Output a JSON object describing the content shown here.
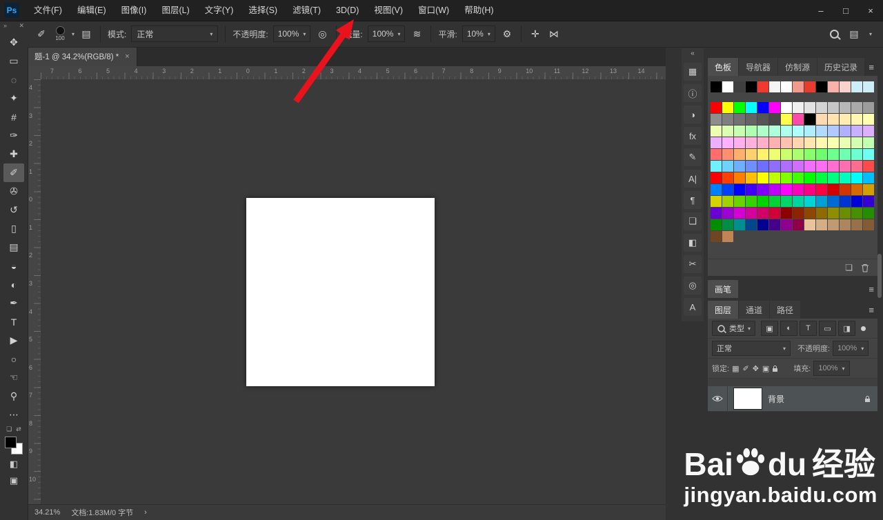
{
  "glyphs": {
    "chevron": "▾",
    "menu": "≡",
    "back": "›"
  },
  "colors": {
    "arrow_red": "#e8131c",
    "canvas_bg": "#3a3a3a",
    "panel_bg": "#434343"
  },
  "menubar": {
    "logo": "Ps",
    "items": [
      "文件(F)",
      "编辑(E)",
      "图像(I)",
      "图层(L)",
      "文字(Y)",
      "选择(S)",
      "滤镜(T)",
      "3D(D)",
      "视图(V)",
      "窗口(W)",
      "帮助(H)"
    ],
    "minimize": "–",
    "maximize": "□",
    "close": "×"
  },
  "left_dock": {
    "collapse": "»",
    "close": "✕",
    "tools": [
      {
        "name": "move-tool",
        "glyph": "✥"
      },
      {
        "name": "marquee-tool",
        "glyph": "▭"
      },
      {
        "name": "lasso-tool",
        "glyph": "◌"
      },
      {
        "name": "quick-selection-tool",
        "glyph": "✦"
      },
      {
        "name": "crop-tool",
        "glyph": "#"
      },
      {
        "name": "eyedropper-tool",
        "glyph": "✑"
      },
      {
        "name": "spot-healing-tool",
        "glyph": "✚"
      },
      {
        "name": "brush-tool",
        "glyph": "✐",
        "selected": true
      },
      {
        "name": "clone-stamp-tool",
        "glyph": "✇"
      },
      {
        "name": "history-brush-tool",
        "glyph": "↺"
      },
      {
        "name": "eraser-tool",
        "glyph": "▯"
      },
      {
        "name": "gradient-tool",
        "glyph": "▤"
      },
      {
        "name": "blur-tool",
        "glyph": "◒"
      },
      {
        "name": "dodge-tool",
        "glyph": "◐"
      },
      {
        "name": "pen-tool",
        "glyph": "✒"
      },
      {
        "name": "type-tool",
        "glyph": "T"
      },
      {
        "name": "path-selection-tool",
        "glyph": "▶"
      },
      {
        "name": "shape-tool",
        "glyph": "○"
      },
      {
        "name": "hand-tool",
        "glyph": "☜"
      },
      {
        "name": "zoom-tool",
        "glyph": "⚲"
      },
      {
        "name": "edit-toolbar-button",
        "glyph": "⋯"
      }
    ],
    "default_colors": "❏",
    "swap_colors": "⇄",
    "quick_mask": "◧",
    "screen_mode": "▣"
  },
  "options_bar": {
    "brush_icon": "✐",
    "brush_size": "100",
    "panel_toggle": "▤",
    "mode_label": "模式:",
    "mode_value": "正常",
    "opacity_label": "不透明度:",
    "opacity_value": "100%",
    "pressure_icon": "◎",
    "flow_label": "流量:",
    "flow_value": "100%",
    "airbrush_icon": "≋",
    "smooth_label": "平滑:",
    "smooth_value": "10%",
    "gear": "⚙",
    "angle_icon": "✛",
    "symmetry_icon": "⋈",
    "workspace_icon": "▤"
  },
  "document_tab": {
    "title": "题-1 @ 34.2%(RGB/8) *",
    "close": "×"
  },
  "rulers": {
    "top": [
      "7",
      "6",
      "5",
      "4",
      "3",
      "2",
      "1",
      "0",
      "1",
      "2",
      "3",
      "4",
      "5",
      "6",
      "7",
      "8",
      "9",
      "10",
      "11",
      "12",
      "13",
      "14"
    ],
    "left": [
      "4",
      "3",
      "2",
      "1",
      "0",
      "1",
      "2",
      "3",
      "4",
      "5",
      "6",
      "7",
      "8",
      "9",
      "10"
    ]
  },
  "status_bar": {
    "zoom": "34.21%",
    "doc_info": "文档:1.83M/0 字节",
    "chevron": "›"
  },
  "right_dock": {
    "collapse": "«",
    "panel_menu": "≡",
    "panel_icons": [
      {
        "name": "swatches-panel-icon",
        "glyph": "▦"
      },
      {
        "name": "info-panel-icon",
        "glyph": "ⓘ"
      },
      {
        "name": "gradient-panel-icon",
        "glyph": "◑"
      },
      {
        "name": "effects-panel-icon",
        "glyph": "fx"
      },
      {
        "name": "brush-settings-panel-icon",
        "glyph": "✎"
      },
      {
        "name": "character-panel-icon",
        "glyph": "A|"
      },
      {
        "name": "paragraph-panel-icon",
        "glyph": "¶"
      },
      {
        "name": "libraries-panel-icon",
        "glyph": "❏"
      },
      {
        "name": "adjustments-panel-icon",
        "glyph": "◧"
      },
      {
        "name": "tool-presets-panel-icon",
        "glyph": "✂"
      },
      {
        "name": "clone-source-panel-icon",
        "glyph": "◎"
      },
      {
        "name": "glyphs-panel-icon",
        "glyph": "A"
      }
    ],
    "panel_tabs": [
      {
        "label": "色板",
        "active": true
      },
      {
        "label": "导航器"
      },
      {
        "label": "仿制源"
      },
      {
        "label": "历史记录"
      }
    ],
    "swatches": {
      "recent": [
        "#000000",
        "#ffffff",
        "#3f3f3f",
        "#000000",
        "#ee3a30",
        "#f5f5f5",
        "#ffffff",
        "#f49a8d",
        "#e83c2e",
        "#000000",
        "#f6b2ab",
        "#fad2cd",
        "#cdeef8",
        "#cdeef8"
      ],
      "grid": [
        "#ff0000",
        "#ffff00",
        "#00ff00",
        "#00ffff",
        "#0000ff",
        "#ff00ff",
        "#ffffff",
        "#f0f0f0",
        "#e2e2e2",
        "#d4d4d4",
        "#c6c6c6",
        "#b8b8b8",
        "#aaaaaa",
        "#9c9c9c",
        "#8e8e8e",
        "#808080",
        "#727272",
        "#646464",
        "#565656",
        "#484848",
        "#ffff4a",
        "#ff4aa8",
        "#000000",
        "#ffd9b0",
        "#ffe3b0",
        "#ffedb0",
        "#fff6b0",
        "#ffffb0",
        "#edffb0",
        "#dbffb0",
        "#c9ffb0",
        "#b0ffb0",
        "#b0ffc9",
        "#b0ffdb",
        "#b0ffed",
        "#b0ffff",
        "#b0edff",
        "#b0dbff",
        "#b0c9ff",
        "#b0b0ff",
        "#c9b0ff",
        "#dbb0ff",
        "#edb0ff",
        "#ffb0ff",
        "#ffb0ed",
        "#ffb0db",
        "#ffb0c9",
        "#ffb0b0",
        "#ffc2b0",
        "#ffd4b0",
        "#ffe6b0",
        "#fff8b0",
        "#f8ffb0",
        "#e6ffb0",
        "#d4ffb0",
        "#c2ffb0",
        "#ff6e6e",
        "#ff8f6e",
        "#ffb06e",
        "#ffd16e",
        "#fff26e",
        "#edff6e",
        "#ccff6e",
        "#abff6e",
        "#8aff6e",
        "#6eff6e",
        "#6eff8f",
        "#6effb0",
        "#6effd1",
        "#6efff2",
        "#6ef2ff",
        "#6ed1ff",
        "#6eb0ff",
        "#6e8fff",
        "#6e6eff",
        "#8f6eff",
        "#b06eff",
        "#d16eff",
        "#f26eff",
        "#ff6ef2",
        "#ff6ed1",
        "#ff6eb0",
        "#ff6e8f",
        "#ff4a4a",
        "#ff0000",
        "#ff4000",
        "#ff8000",
        "#ffbf00",
        "#ffff00",
        "#bfff00",
        "#80ff00",
        "#40ff00",
        "#00ff00",
        "#00ff40",
        "#00ff80",
        "#00ffbf",
        "#00ffff",
        "#00bfff",
        "#0080ff",
        "#0040ff",
        "#0000ff",
        "#4000ff",
        "#8000ff",
        "#bf00ff",
        "#ff00ff",
        "#ff00bf",
        "#ff0080",
        "#ff0040",
        "#d40000",
        "#d43500",
        "#d46a00",
        "#d49f00",
        "#d4d400",
        "#9fd400",
        "#6ad400",
        "#35d400",
        "#00d400",
        "#00d435",
        "#00d46a",
        "#00d49f",
        "#00d4d4",
        "#009fd4",
        "#006ad4",
        "#0035d4",
        "#0000d4",
        "#3500d4",
        "#6a00d4",
        "#9f00d4",
        "#d400d4",
        "#d4009f",
        "#d4006a",
        "#d40035",
        "#8e0000",
        "#8e2300",
        "#8e4700",
        "#8e6a00",
        "#8e8e00",
        "#6a8e00",
        "#478e00",
        "#238e00",
        "#008e00",
        "#008e47",
        "#008e8e",
        "#00478e",
        "#00008e",
        "#47008e",
        "#8e008e",
        "#8e0047",
        "#e8c49a",
        "#d4af86",
        "#bf9a72",
        "#ab865e",
        "#96714a",
        "#825c36",
        "#6e4722",
        "#c08552"
      ]
    },
    "new_swatch_icon": "❏",
    "brushes_tab": "画笔",
    "layers_tabs": [
      {
        "label": "图层",
        "active": true
      },
      {
        "label": "通道"
      },
      {
        "label": "路径"
      }
    ],
    "layers": {
      "filter_label": "类型",
      "filter_icons": [
        {
          "name": "filter-pixel-layers-icon",
          "glyph": "▣"
        },
        {
          "name": "filter-adjustment-layers-icon",
          "glyph": "◐"
        },
        {
          "name": "filter-type-layers-icon",
          "glyph": "T"
        },
        {
          "name": "filter-shape-layers-icon",
          "glyph": "▭"
        },
        {
          "name": "filter-smart-objects-icon",
          "glyph": "◨"
        }
      ],
      "blend_mode": "正常",
      "opacity_label": "不透明度:",
      "opacity_value": "100%",
      "lock_label": "锁定:",
      "lock_icons": [
        {
          "name": "lock-transparency-icon",
          "glyph": "▦"
        },
        {
          "name": "lock-paint-icon",
          "glyph": "✐"
        },
        {
          "name": "lock-position-icon",
          "glyph": "✥"
        },
        {
          "name": "lock-artboard-icon",
          "glyph": "▣"
        }
      ],
      "fill_label": "填充:",
      "fill_value": "100%",
      "layer_name": "背景"
    }
  },
  "watermark": {
    "brand_a": "Bai",
    "brand_b": "du",
    "brand_c": "经验",
    "url": "jingyan.baidu.com"
  }
}
